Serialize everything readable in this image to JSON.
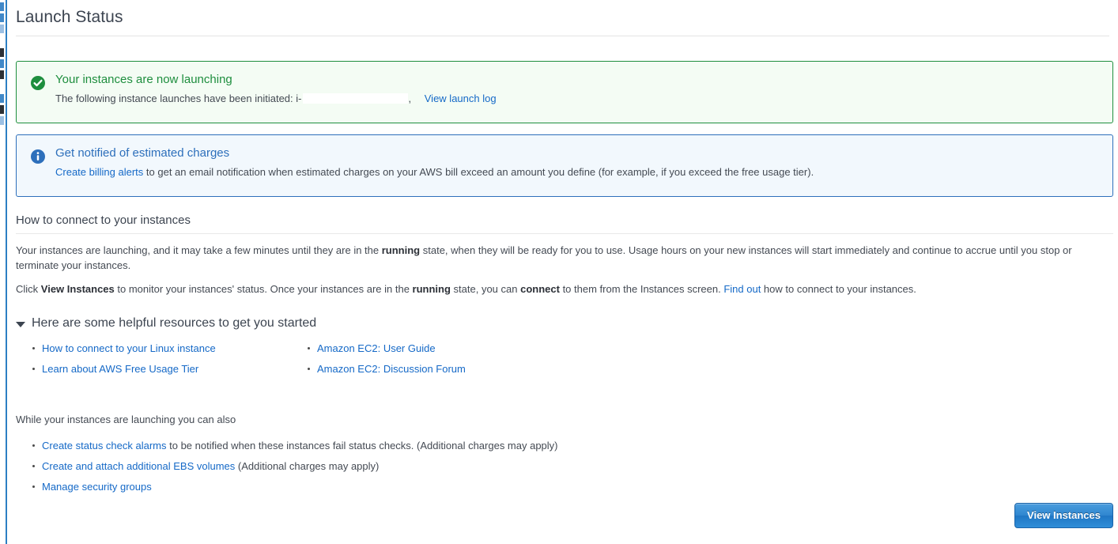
{
  "page": {
    "title": "Launch Status"
  },
  "alerts": {
    "success": {
      "icon": "check-circle-icon",
      "heading": "Your instances are now launching",
      "body_prefix": "The following instance launches have been initiated:",
      "instance_id_prefix": "i-",
      "instance_id_redacted": true,
      "body_suffix": ",",
      "link_label": "View launch log",
      "accent_color": "#1e8e3e",
      "background_color": "#f4fcf4"
    },
    "info": {
      "icon": "info-circle-icon",
      "heading": "Get notified of estimated charges",
      "link_label": "Create billing alerts",
      "body": "to get an email notification when estimated charges on your AWS bill exceed an amount you define (for example, if you exceed the free usage tier).",
      "accent_color": "#2d6fbb",
      "background_color": "#f2f8fd"
    }
  },
  "connect_section": {
    "heading": "How to connect to your instances",
    "paragraph1": {
      "part1": "Your instances are launching, and it may take a few minutes until they are in the ",
      "bold1": "running",
      "part2": " state, when they will be ready for you to use. Usage hours on your new instances will start immediately and continue to accrue until you stop or terminate your instances."
    },
    "paragraph2": {
      "part1": "Click ",
      "bold1": "View Instances",
      "part2": " to monitor your instances' status. Once your instances are in the ",
      "bold2": "running",
      "part3": " state, you can ",
      "bold3": "connect",
      "part4": " to them from the Instances screen. ",
      "link": "Find out",
      "part5": " how to connect to your instances."
    }
  },
  "resources_section": {
    "caret": "caret-down-icon",
    "heading": "Here are some helpful resources to get you started",
    "column1": [
      {
        "label": "How to connect to your Linux instance"
      },
      {
        "label": "Learn about AWS Free Usage Tier"
      }
    ],
    "column2": [
      {
        "label": "Amazon EC2: User Guide"
      },
      {
        "label": "Amazon EC2: Discussion Forum"
      }
    ]
  },
  "also_section": {
    "intro": "While your instances are launching you can also",
    "items": [
      {
        "link": "Create status check alarms",
        "text": " to be notified when these instances fail status checks. (Additional charges may apply)"
      },
      {
        "link": "Create and attach additional EBS volumes",
        "text": " (Additional charges may apply)"
      },
      {
        "link": "Manage security groups",
        "text": ""
      }
    ]
  },
  "footer": {
    "primary_button": "View Instances",
    "primary_button_color": "#2f86d0"
  }
}
